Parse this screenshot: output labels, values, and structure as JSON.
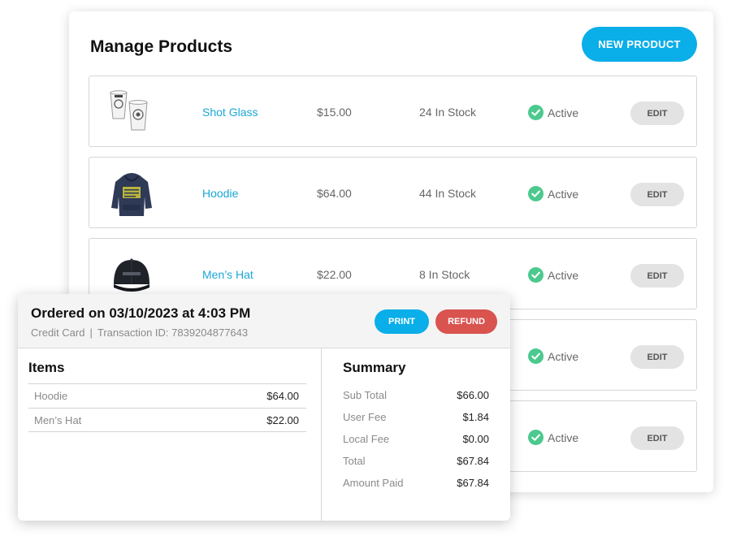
{
  "products": {
    "title": "Manage Products",
    "new_button": "NEW PRODUCT",
    "rows": [
      {
        "name": "Shot Glass",
        "price": "$15.00",
        "stock": "24 In Stock",
        "status": "Active",
        "edit": "EDIT",
        "thumb_icon": "shot-glass-icon"
      },
      {
        "name": "Hoodie",
        "price": "$64.00",
        "stock": "44 In Stock",
        "status": "Active",
        "edit": "EDIT",
        "thumb_icon": "hoodie-icon"
      },
      {
        "name": "Men’s Hat",
        "price": "$22.00",
        "stock": "8 In Stock",
        "status": "Active",
        "edit": "EDIT",
        "thumb_icon": "hat-icon"
      },
      {
        "status": "Active",
        "edit": "EDIT"
      },
      {
        "status": "Active",
        "edit": "EDIT"
      }
    ]
  },
  "order": {
    "title": "Ordered on 03/10/2023 at 4:03 PM",
    "payment_method": "Credit Card",
    "separator": "|",
    "transaction": "Transaction ID: 7839204877643",
    "print_button": "PRINT",
    "refund_button": "REFUND",
    "items_heading": "Items",
    "items": [
      {
        "name": "Hoodie",
        "price": "$64.00"
      },
      {
        "name": "Men’s Hat",
        "price": "$22.00"
      }
    ],
    "summary_heading": "Summary",
    "summary": [
      {
        "label": "Sub Total",
        "value": "$66.00"
      },
      {
        "label": "User Fee",
        "value": "$1.84"
      },
      {
        "label": "Local Fee",
        "value": "$0.00"
      },
      {
        "label": "Total",
        "value": "$67.84"
      },
      {
        "label": "Amount Paid",
        "value": "$67.84"
      }
    ]
  },
  "colors": {
    "accent": "#0aaee8",
    "danger": "#d9534f",
    "link": "#1aa7d6",
    "status_active": "#4cc98e"
  }
}
